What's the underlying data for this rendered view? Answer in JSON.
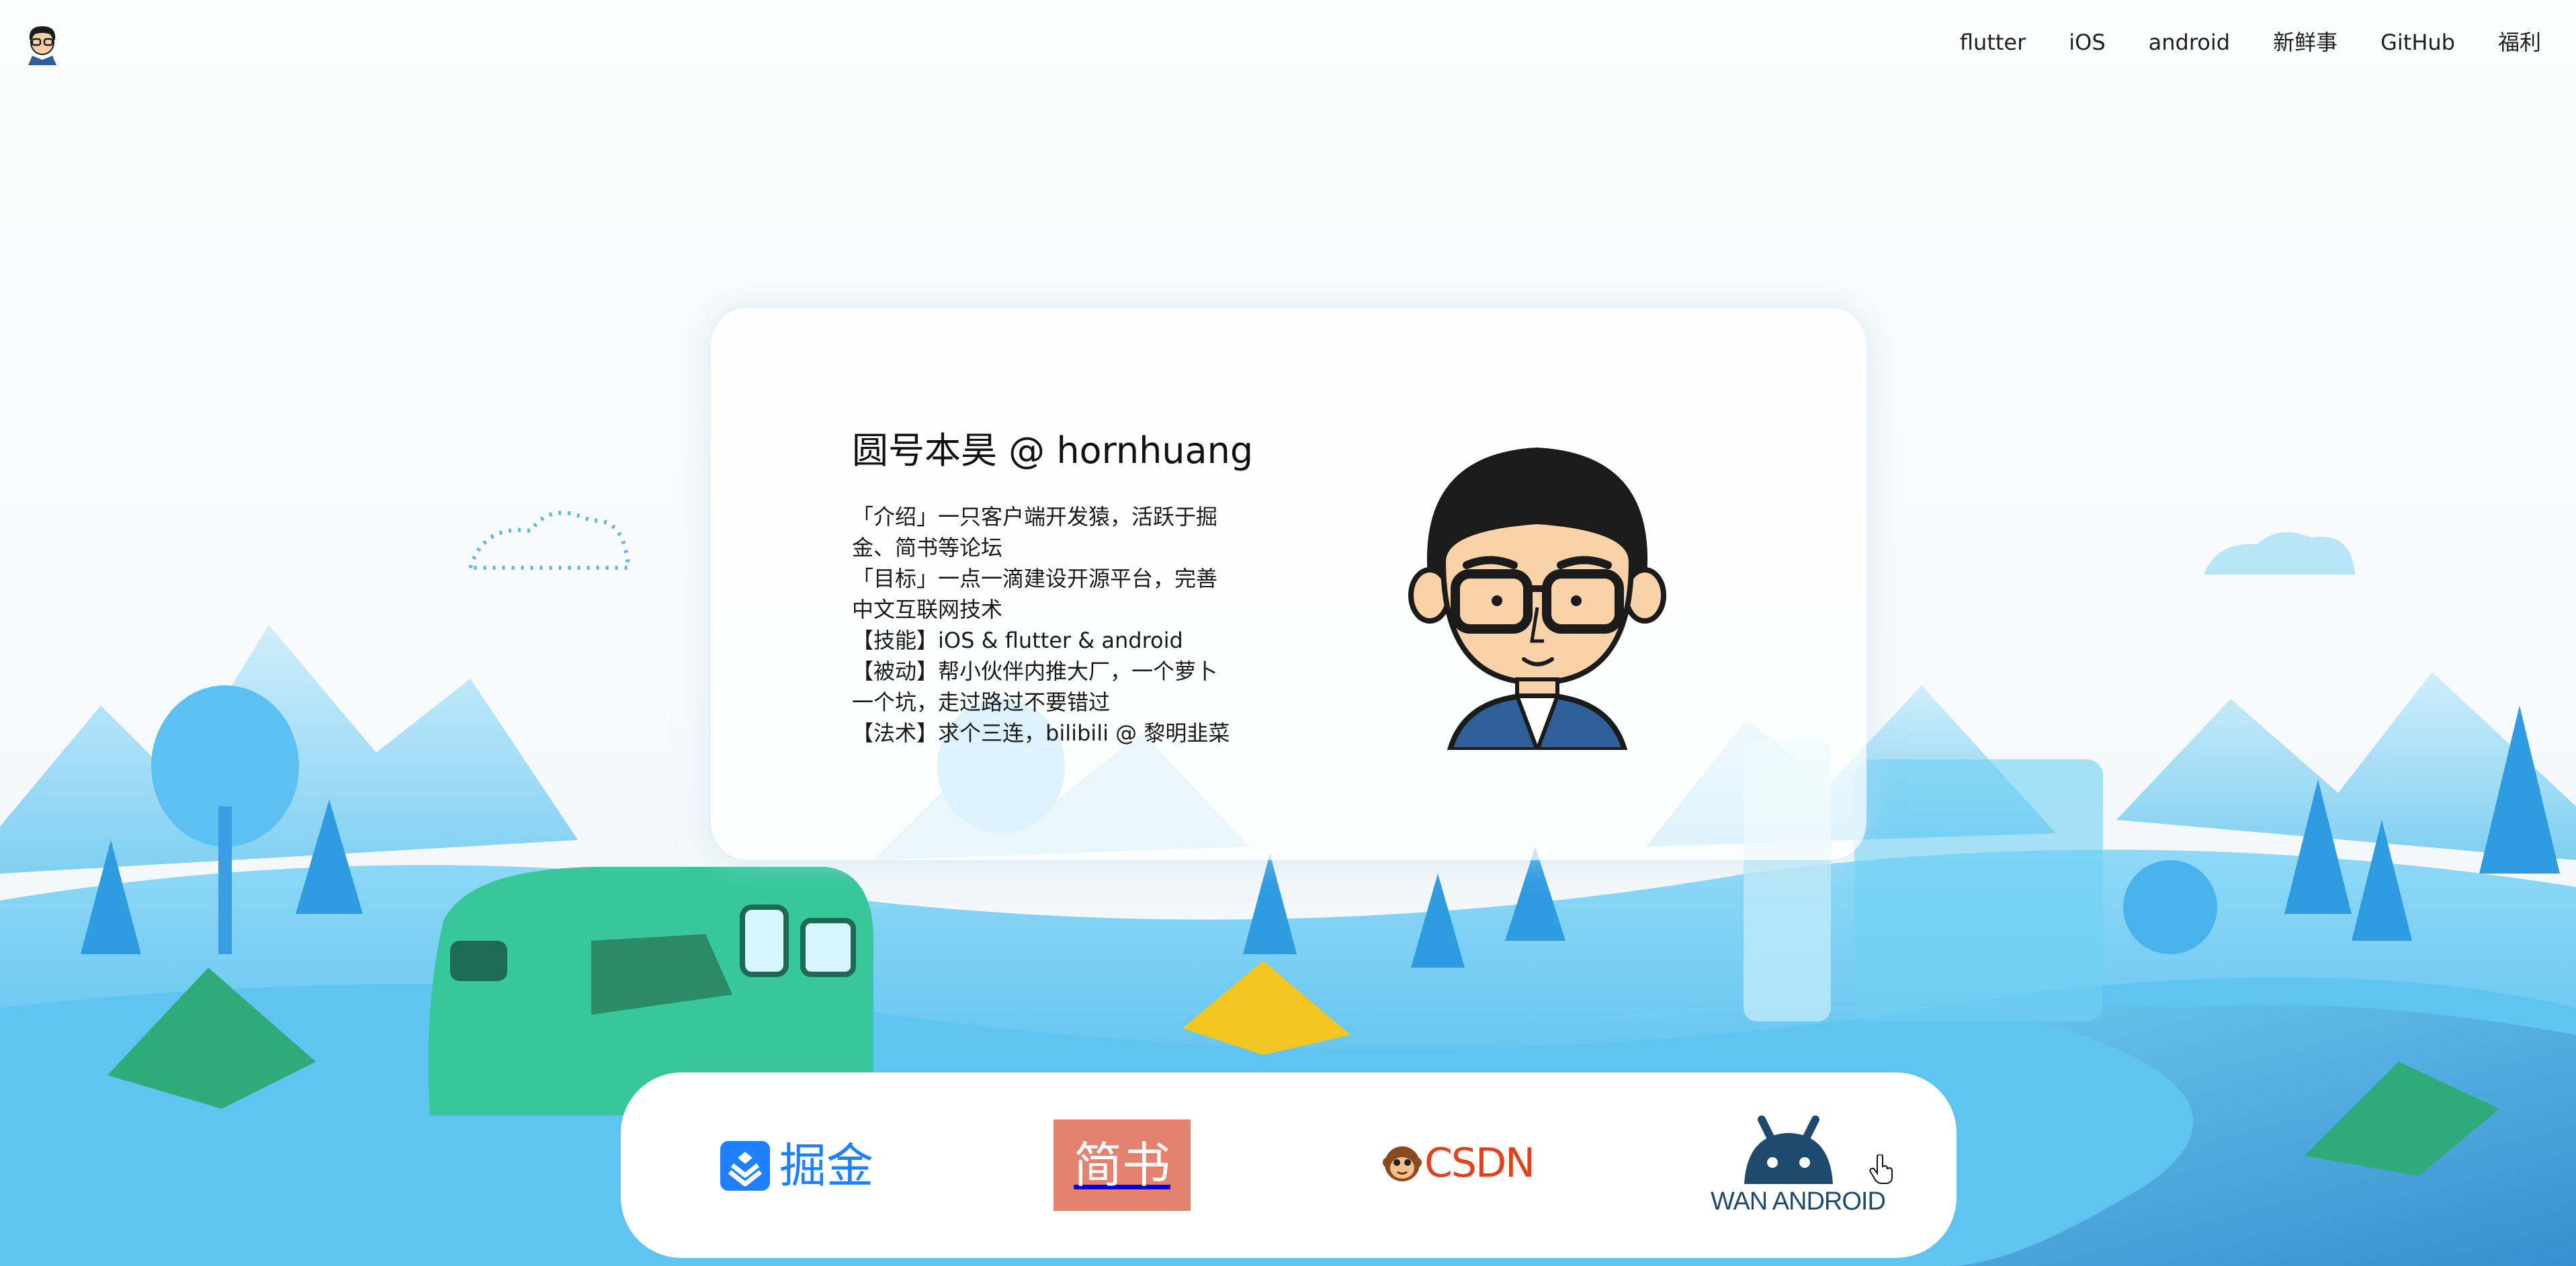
{
  "nav": {
    "items": [
      "flutter",
      "iOS",
      "android",
      "新鲜事",
      "GitHub",
      "福利"
    ]
  },
  "profile": {
    "title": "圆号本昊 @ hornhuang",
    "lines": [
      "「介绍」一只客户端开发猿，活跃于掘",
      "金、简书等论坛",
      "「目标」一点一滴建设开源平台，完善",
      "中文互联网技术",
      "【技能】iOS & flutter & android",
      "【被动】帮小伙伴内推大厂，一个萝卜",
      "一个坑，走过路过不要错过",
      "【法术】求个三连，bilibili @ 黎明韭菜"
    ]
  },
  "links": {
    "juejin": "掘金",
    "jianshu": "简书",
    "csdn": "CSDN",
    "wanandroid": "WAN ANDROID"
  },
  "colors": {
    "juejin_blue": "#1e80ff",
    "jianshu_red": "#e5826f",
    "csdn_red": "#e3401b",
    "wanandroid_navy": "#1f4a6e"
  },
  "icons": [
    "avatar-logo",
    "profile-avatar",
    "juejin-logo-icon",
    "csdn-monkey-icon",
    "android-head-icon",
    "hand-pointer-cursor-icon"
  ]
}
